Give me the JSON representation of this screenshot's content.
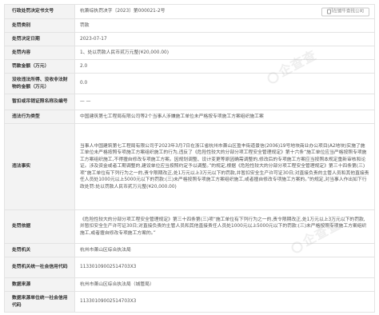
{
  "rows": [
    {
      "label": "行政处罚决定书文号",
      "value": "杭萧综执罚决字〔2023〕第000021-2号"
    },
    {
      "label": "处罚类别",
      "value": "罚款"
    },
    {
      "label": "处罚决定日期",
      "value": "2023-07-17"
    },
    {
      "label": "处罚内容",
      "value": "1、处以罚款人民币贰万元整(¥20,000.00)"
    },
    {
      "label": "罚款金额（万元）",
      "value": "2.0"
    },
    {
      "label": "没收违法所得、没收非法财物的金额（万元）",
      "value": "0.0"
    },
    {
      "label": "暂扣或吊销证照名称及编号",
      "value": "— —"
    },
    {
      "label": "违法行为类型",
      "value": "中国建筑第七工程局有限公司等2个当事人涉嫌施工单位未严格按专项施工方案组织施工案"
    },
    {
      "label": "违法事实",
      "value": "当事人中国建筑第七工程局有限公司于2023年3月7日在浙江省杭州市萧山区盈丰街道景信(2006)19号地块商业办公项目(A2地块)实施了施工单位未严格按照专项施工方案组织施工的行为,违反了《危险性较大的分部分项工程安全管理规定》第十六条“施工单位应当严格按照专项施工方案组织施工,不得擅自修改专项施工方案。因规划调整、设计变更等原因确需调整的,修改后的专项施工方案应当按照本规定重新审核和论证。涉及资金或者工期调整的,建设单位应当按照约定予以调整。”的规定,根据《危险性较大的分部分项工程安全管理规定》第三十四条第(三)项“施工单位有下列行为之一的,责令限期改正,处1万元以上3万元以下的罚款,并暂扣安全生产许可证30日;对直接负责的主管人员和其他直接责任人员处1000元以上5000元以下的罚款:(三)未严格按照专项施工方案组织施工,或者擅自修改专项施工方案的。”的规定,对当事人作出如下行政处罚:处以罚款人民币贰万元整(¥20,000.00)"
    },
    {
      "label": "处罚依据",
      "value": "《危险性较大的分部分项工程安全管理规定》第三十四条第(三)项“施工单位有下列行为之一的,责令限期改正,处1万元以上3万元以下的罚款,并暂扣安全生产许可证30日;对直接负责的主管人员和其他直接责任人员处1000元以上5000元以下的罚款:(三)未严格按照专项施工方案组织施工,或者擅自修改专项施工方案的。”"
    },
    {
      "label": "处罚机关",
      "value": "杭州市萧山区综合执法局"
    },
    {
      "label": "处罚机关统一社会信用代码",
      "value": "11330109002514703X3"
    },
    {
      "label": "数据来源",
      "value": "杭州市萧山区综合执法局（城管局）"
    },
    {
      "label": "数据来源单位统一社会信用代码",
      "value": "11330109002514703X3"
    }
  ],
  "copy_button": {
    "label": "在键牛查找公司",
    "icon": "copy-icon"
  },
  "watermark": {
    "text": "企查查",
    "color": "#969696"
  }
}
